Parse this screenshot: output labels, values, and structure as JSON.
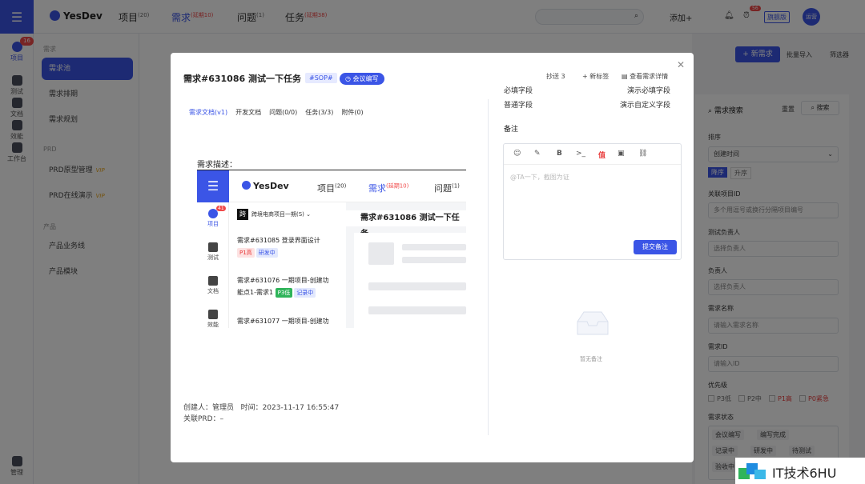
{
  "app": {
    "brand": "YesDev"
  },
  "rail": {
    "badge": "16",
    "items": [
      {
        "label": "项目"
      },
      {
        "label": "测试"
      },
      {
        "label": "文档"
      },
      {
        "label": "效能"
      },
      {
        "label": "工作台"
      },
      {
        "label": "管理"
      }
    ]
  },
  "topbar": {
    "nav": [
      {
        "label": "项目",
        "sup": "(20)"
      },
      {
        "label": "需求",
        "sup": "(延期10)"
      },
      {
        "label": "问题",
        "sup": "(1)"
      },
      {
        "label": "任务",
        "sup": "(延期38)"
      }
    ],
    "add_label": "添加+",
    "notif_badge": "56",
    "enterprise_label": "旗舰版",
    "avatar_label": "运营"
  },
  "sidebar": {
    "groups": [
      "需求",
      "PRD",
      "产品"
    ],
    "items": [
      {
        "label": "需求池",
        "vip": ""
      },
      {
        "label": "需求排期",
        "vip": ""
      },
      {
        "label": "需求规划",
        "vip": ""
      },
      {
        "label": "PRD原型管理",
        "vip": "VIP"
      },
      {
        "label": "PRD在线演示",
        "vip": "VIP"
      },
      {
        "label": "产品业务线",
        "vip": ""
      },
      {
        "label": "产品模块",
        "vip": ""
      }
    ]
  },
  "toolbar": {
    "new_label": "+ 新需求",
    "import_label": "批量导入",
    "filter_label": "筛选器"
  },
  "filter": {
    "title": "需求搜索",
    "reset": "重置",
    "search": "搜索",
    "sort_label": "排序",
    "sort_value": "创建时间",
    "sort_opts": [
      "降序",
      "升序"
    ],
    "project_label": "关联项目ID",
    "project_ph": "多个用逗号或换行分隔项目编号",
    "tester_label": "测试负责人",
    "tester_ph": "选择负责人",
    "owner_label": "负责人",
    "owner_ph": "选择负责人",
    "name_label": "需求名称",
    "name_ph": "请输入需求名称",
    "id_label": "需求ID",
    "id_ph": "请输入ID",
    "priority_label": "优先级",
    "priorities": [
      "P3低",
      "P2中",
      "P1高",
      "P0紧急"
    ],
    "status_label": "需求状态",
    "statuses": [
      "会议编写",
      "编写完成",
      "记录中",
      "研发中",
      "待测试",
      "验收中"
    ]
  },
  "modal": {
    "title": "需求#631086 测试一下任务",
    "tag_sop": "#SOP#",
    "tag_meeting": "会议编写",
    "cc": "抄送 3",
    "new_tag": "+ 新标签",
    "view_detail": "查看需求详情",
    "tabs": [
      "需求文档(v1)",
      "开发文档",
      "问题(0/0)",
      "任务(3/3)",
      "附件(0)"
    ],
    "desc_label": "需求描述：",
    "creator": "创建人：管理员   时间：2023-11-17 16:55:47",
    "prd": "关联PRD：–",
    "fields": [
      {
        "k": "必填字段",
        "v": "演示必填字段"
      },
      {
        "k": "普通字段",
        "v": "演示自定义字段"
      }
    ],
    "remark_label": "备注",
    "editor_tools": [
      "☺",
      "✎",
      "B",
      ">_",
      "值",
      "▣",
      "⛓"
    ],
    "editor_ph": "@TA一下，截图为证",
    "submit": "提交备注",
    "empty": "暂无备注"
  },
  "embedded": {
    "brand": "YesDev",
    "badge": "41",
    "nav": [
      {
        "label": "项目",
        "sup": "(20)"
      },
      {
        "label": "需求",
        "sup": "(延期10)"
      },
      {
        "label": "问题",
        "sup": "(1)"
      }
    ],
    "rail": [
      "项目",
      "测试",
      "文档",
      "效能"
    ],
    "project_badge": "跨",
    "project": "跨境电商项目一期(S) ⌄",
    "detail_title": "需求#631086 测试一下任务",
    "items": [
      {
        "title": "需求#631085 登录界面设计",
        "title2": "",
        "p": "P1高",
        "s": "研发中"
      },
      {
        "title": "需求#631076 一期项目-创建功",
        "title2": "能点1-需求1",
        "p": "P3低",
        "s": "记录中"
      },
      {
        "title": "需求#631077 一期项目-创建功",
        "title2": "",
        "p": "",
        "s": ""
      }
    ]
  },
  "watermark": "IT技术6HU"
}
